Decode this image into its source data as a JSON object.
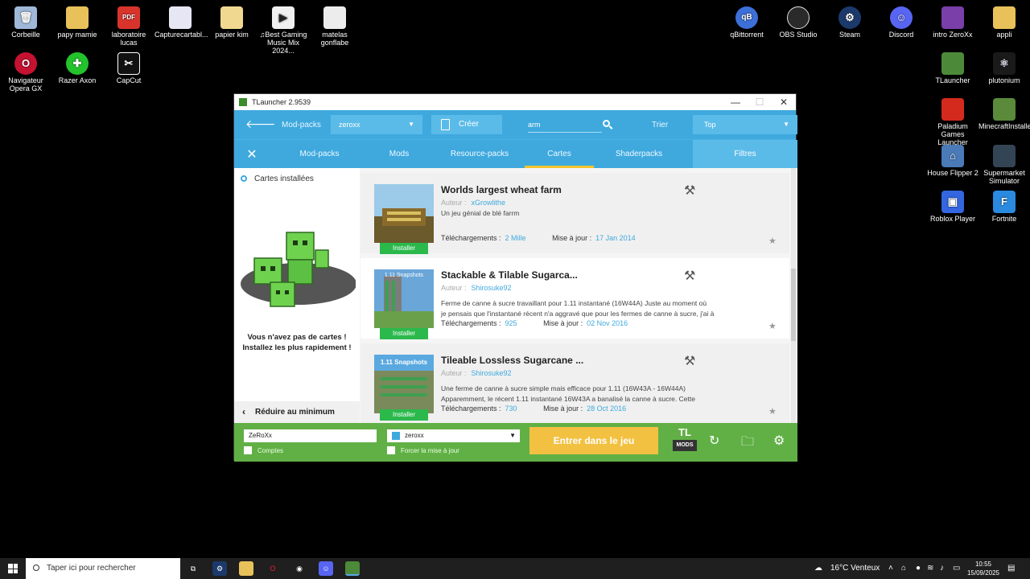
{
  "desktop": {
    "icons_left": [
      {
        "label": "Corbeille",
        "icon": "recycle-bin-icon",
        "color": "#9fb8d8"
      },
      {
        "label": "papy mamie",
        "icon": "folder-icon",
        "color": "#e8c15a"
      },
      {
        "label": "laboratoire lucas",
        "icon": "pdf-icon",
        "color": "#d8342c"
      },
      {
        "label": "Capturecartabl...",
        "icon": "image-icon",
        "color": "#e6e6f5"
      },
      {
        "label": "papier kim",
        "icon": "folder-icon",
        "color": "#f0d890"
      },
      {
        "label": "♫Best Gaming Music Mix 2024...",
        "icon": "video-icon",
        "color": "#f0f0f0"
      },
      {
        "label": "matelas gonflabe",
        "icon": "image-icon",
        "color": "#ececec"
      },
      {
        "label": "Navigateur Opera GX",
        "icon": "opera-icon",
        "color": "#c41230"
      },
      {
        "label": "Razer Axon",
        "icon": "razer-icon",
        "color": "#23c32c"
      },
      {
        "label": "CapCut",
        "icon": "capcut-icon",
        "color": "#111111"
      }
    ],
    "icons_right": [
      {
        "label": "qBittorrent",
        "icon": "qbittorrent-icon",
        "color": "#3c6fd8"
      },
      {
        "label": "OBS Studio",
        "icon": "obs-icon",
        "color": "#2a2a2a"
      },
      {
        "label": "Steam",
        "icon": "steam-icon",
        "color": "#1b3a6b"
      },
      {
        "label": "Discord",
        "icon": "discord-icon",
        "color": "#5865f2"
      },
      {
        "label": "intro ZeroXx",
        "icon": "video-file-icon",
        "color": "#7a3fa8"
      },
      {
        "label": "appli",
        "icon": "folder-icon",
        "color": "#e8c15a"
      },
      {
        "label": "TLauncher",
        "icon": "tlauncher-icon",
        "color": "#4c8a3a"
      },
      {
        "label": "plutonium",
        "icon": "plutonium-icon",
        "color": "#1a1a1a"
      },
      {
        "label": "Paladium Games Launcher",
        "icon": "paladium-icon",
        "color": "#d42a1e"
      },
      {
        "label": "MinecraftInstaller",
        "icon": "minecraft-icon",
        "color": "#5a8a3a"
      },
      {
        "label": "House Flipper 2",
        "icon": "house-icon",
        "color": "#4a7ab8"
      },
      {
        "label": "Supermarket Simulator",
        "icon": "supermarket-icon",
        "color": "#334455"
      },
      {
        "label": "Roblox Player",
        "icon": "roblox-icon",
        "color": "#3366e0"
      },
      {
        "label": "Fortnite",
        "icon": "fortnite-icon",
        "color": "#2a8ae0"
      }
    ]
  },
  "window": {
    "title": "TLauncher 2.9539",
    "controls": {
      "minimize": "—",
      "maximize": "☐",
      "close": "✕"
    },
    "topbar": {
      "modpacks_label": "Mod-packs",
      "modpack_value": "zeroxx",
      "create_label": "Créer",
      "search_value": "arm",
      "sort_label": "Trier",
      "sort_value": "Top"
    },
    "tabs": [
      "Mod-packs",
      "Mods",
      "Resource-packs",
      "Cartes",
      "Shaderpacks"
    ],
    "active_tab": "Cartes",
    "filters_label": "Filtres",
    "sidebar": {
      "installed_label": "Cartes installées",
      "empty_line1": "Vous n'avez pas de cartes !",
      "empty_line2": "Installez les plus rapidement !",
      "reduce_label": "Réduire au minimum"
    },
    "cards": [
      {
        "title": "Worlds largest wheat farm",
        "author_label": "Auteur :",
        "author": "xGrowlithe",
        "desc1": "Un jeu génial de blé farrm",
        "desc2": "",
        "downloads_label": "Téléchargements :",
        "downloads": "2 Mille",
        "updated_label": "Mise à jour :",
        "updated": "17 Jan 2014",
        "install_label": "Installer"
      },
      {
        "title": "Stackable & Tilable Sugarca...",
        "author_label": "Auteur :",
        "author": "Shirosuke92",
        "desc1": "Ferme de canne à sucre travaillant pour 1.11 instantané (16W44A) Juste au moment où",
        "desc2": "je pensais que l'instantané récent n'a aggravé que pour les fermes de canne à sucre, j'ai à",
        "downloads_label": "Téléchargements :",
        "downloads": "925",
        "updated_label": "Mise à jour :",
        "updated": "02 Nov 2016",
        "install_label": "Installer",
        "thumb_text": "1.11 Snapshots"
      },
      {
        "title": "Tileable Lossless Sugarcane ...",
        "author_label": "Auteur :",
        "author": "Shirosuke92",
        "desc1": "Une ferme de canne à sucre simple mais efficace pour 1.11 (16W43A - 16W44A)",
        "desc2": "Apparemment, le récent 1.11 instantané 16W43A a banalisé la canne à sucre. Cette",
        "downloads_label": "Téléchargements :",
        "downloads": "730",
        "updated_label": "Mise à jour :",
        "updated": "28 Oct 2016",
        "install_label": "Installer",
        "thumb_text": "1.11 Snapshots"
      }
    ],
    "bottombar": {
      "username": "ZeRoXx",
      "accounts_label": "Comptes",
      "version_value": "zeroxx",
      "force_update_label": "Forcer la mise à jour",
      "play_label": "Entrer dans le jeu",
      "tl_logo": "TL",
      "tl_logo_sub": "MODS"
    }
  },
  "taskbar": {
    "search_placeholder": "Taper ici pour rechercher",
    "weather": "16°C Venteux",
    "time": "10:55",
    "date": "15/09/2025"
  },
  "colors": {
    "accent_blue": "#3fa9de",
    "accent_green": "#61b046",
    "install_green": "#2bb94c",
    "play_yellow": "#f3c142",
    "tab_underline": "#f5c42a"
  }
}
